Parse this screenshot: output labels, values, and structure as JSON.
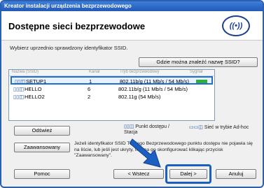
{
  "window": {
    "title": "Kreator instalacji urządzenia bezprzewodowego"
  },
  "header": {
    "title": "Dostępne sieci bezprzewodowe",
    "logo_icon": "brother-wireless-logo"
  },
  "instruction": "Wybierz uprzednio sprawdzony identyfikator SSID.",
  "help_button": "Gdzie można znaleźć nazwę SSID?",
  "list": {
    "columns": [
      "Nazwa (SSID)",
      "Kanał",
      "Tryb bezprzewodowy",
      "Sygnał"
    ],
    "rows": [
      {
        "name": "SETUP1",
        "channel": "1",
        "mode": "802.11b/g (11 Mb/s / 54 Mb/s)",
        "selected": true
      },
      {
        "name": "HELLO",
        "channel": "6",
        "mode": "802.11b/g (11 Mb/s / 54 Mb/s)",
        "selected": false
      },
      {
        "name": "HELLO2",
        "channel": "2",
        "mode": "802.11g (54 Mb/s)",
        "selected": false
      }
    ]
  },
  "refresh_button": "Odśwież",
  "legend": {
    "access_point": "Punkt dostępu / Stacja",
    "adhoc": "Sieć w trybie Ad-hoc"
  },
  "advanced_button": "Zaawansowany",
  "info_text": "Jeżeli identyfikator SSID Twojego Bezprzewodowego punktu dostępu nie pojawia się na liście, lub jeśli jest ukryty, można go skonfigurować klikając przycisk \"Zaawansowany\".",
  "footer": {
    "help": "Pomoc",
    "back": "< Wstecz",
    "next": "Dalej >",
    "cancel": "Anuluj"
  },
  "colors": {
    "accent": "#1b5fc0",
    "signal": "#2fae3e"
  }
}
